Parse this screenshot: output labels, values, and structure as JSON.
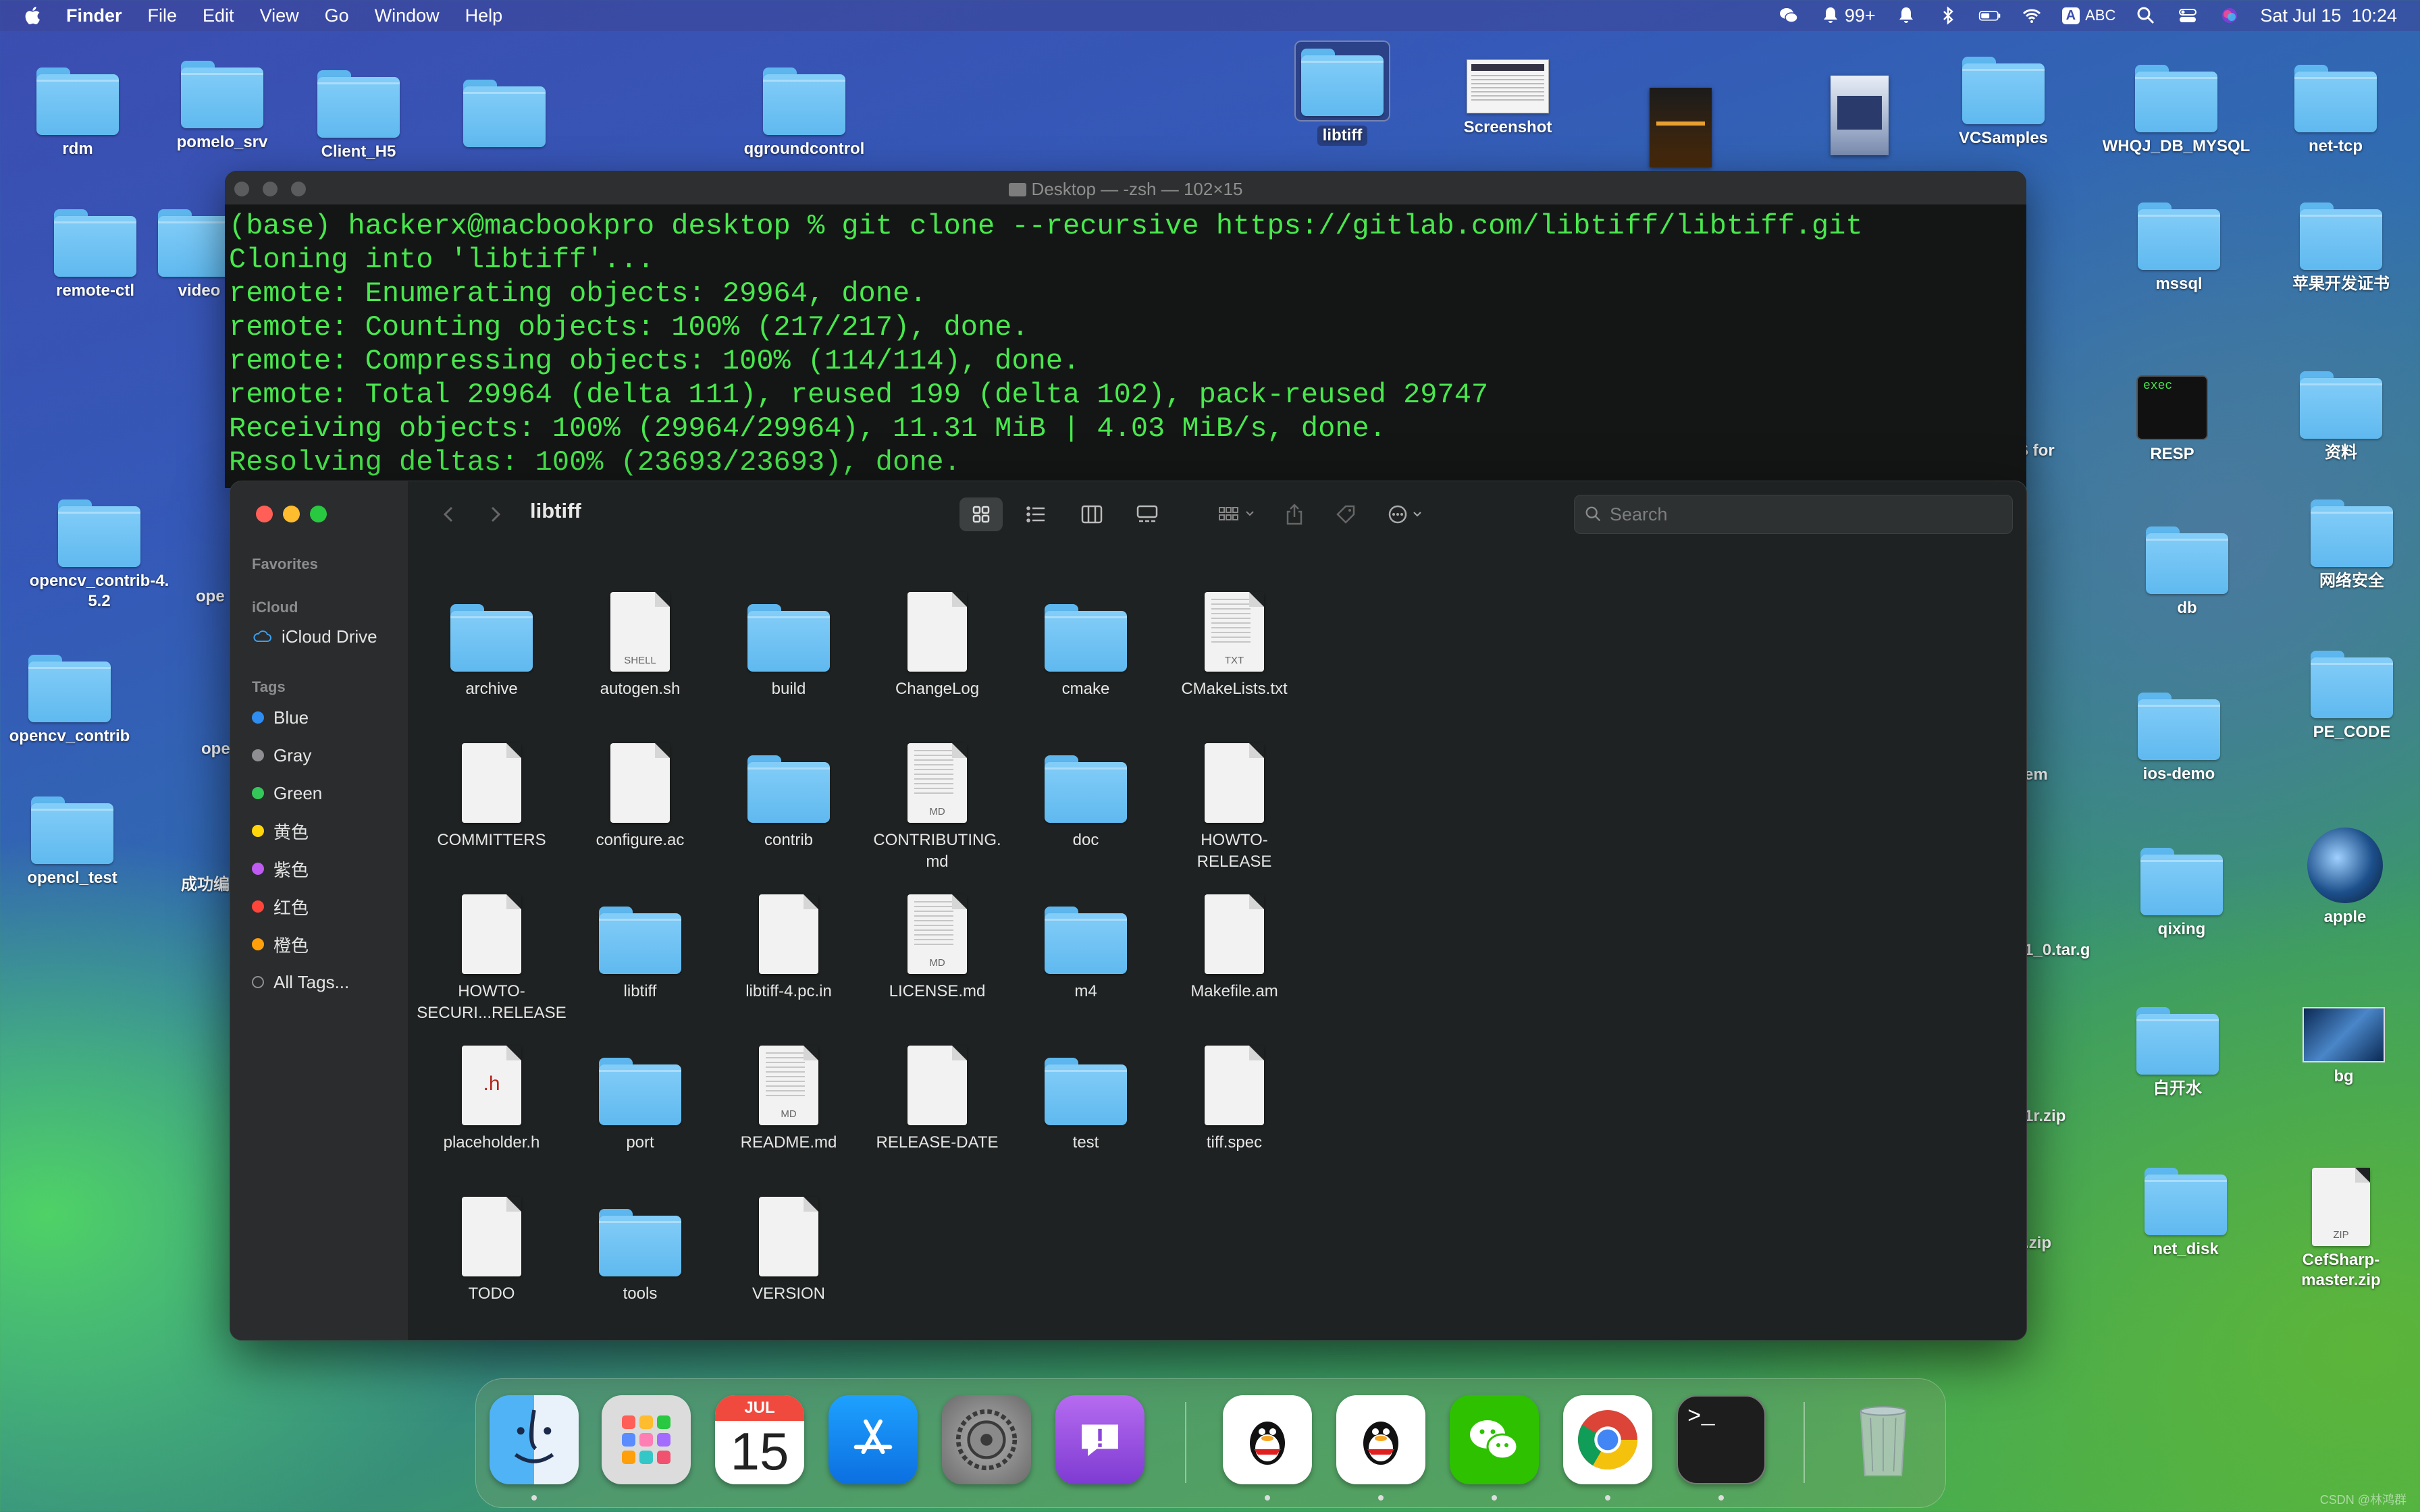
{
  "menubar": {
    "app": "Finder",
    "items": [
      "File",
      "Edit",
      "View",
      "Go",
      "Window",
      "Help"
    ],
    "notification_count": "99+",
    "input_mode_badge": "A",
    "input_mode_label": "ABC",
    "clock": "Sat Jul 15  10:24"
  },
  "desktop_icons": [
    {
      "label": "rdm",
      "type": "folder"
    },
    {
      "label": "pomelo_srv",
      "type": "folder"
    },
    {
      "label": "Client_H5",
      "type": "folder"
    },
    {
      "label": "",
      "type": "folder"
    },
    {
      "label": "qgroundcontrol",
      "type": "folder"
    },
    {
      "label": "libtiff",
      "type": "folder"
    },
    {
      "label": "Screenshot",
      "type": "image"
    },
    {
      "label": "",
      "type": "book"
    },
    {
      "label": "",
      "type": "book"
    },
    {
      "label": "VCSamples",
      "type": "folder"
    },
    {
      "label": "WHQJ_DB_MYSQL",
      "type": "folder"
    },
    {
      "label": "net-tcp",
      "type": "folder"
    },
    {
      "label": "remote-ctl",
      "type": "folder"
    },
    {
      "label": "video",
      "type": "folder"
    },
    {
      "label": "mssql",
      "type": "folder"
    },
    {
      "label": "苹果开发证书",
      "type": "folder"
    },
    {
      "label": "RESP",
      "type": "exec"
    },
    {
      "label": "资料",
      "type": "folder"
    },
    {
      "label": "ES for",
      "type": "text"
    },
    {
      "label": "opencv_contrib-4.\n5.2",
      "type": "folder"
    },
    {
      "label": "ope",
      "type": "folder"
    },
    {
      "label": "db",
      "type": "folder"
    },
    {
      "label": "网络安全",
      "type": "folder"
    },
    {
      "label": "opencv_contrib",
      "type": "folder"
    },
    {
      "label": "ope",
      "type": "folder"
    },
    {
      "label": "PE_CODE",
      "type": "folder"
    },
    {
      "label": "em",
      "type": "text"
    },
    {
      "label": "ios-demo",
      "type": "folder"
    },
    {
      "label": "opencl_test",
      "type": "folder"
    },
    {
      "label": "成功编",
      "type": "folder"
    },
    {
      "label": "1_0.tar.g",
      "type": "doc"
    },
    {
      "label": "qixing",
      "type": "folder"
    },
    {
      "label": "apple",
      "type": "image"
    },
    {
      "label": "1r.zip",
      "type": "doc"
    },
    {
      "label": "白开水",
      "type": "folder"
    },
    {
      "label": "bg",
      "type": "image"
    },
    {
      "label": ".zip",
      "type": "doc"
    },
    {
      "label": "net_disk",
      "type": "folder"
    },
    {
      "label": "CefSharp-\nmaster.zip",
      "type": "zip"
    }
  ],
  "terminal": {
    "title": "Desktop — -zsh — 102×15",
    "lines": [
      "(base) hackerx@macbookpro desktop % git clone --recursive https://gitlab.com/libtiff/libtiff.git",
      "Cloning into 'libtiff'...",
      "remote: Enumerating objects: 29964, done.",
      "remote: Counting objects: 100% (217/217), done.",
      "remote: Compressing objects: 100% (114/114), done.",
      "remote: Total 29964 (delta 111), reused 199 (delta 102), pack-reused 29747",
      "Receiving objects: 100% (29964/29964), 11.31 MiB | 4.03 MiB/s, done.",
      "Resolving deltas: 100% (23693/23693), done."
    ]
  },
  "finder": {
    "title": "libtiff",
    "search_placeholder": "Search",
    "sidebar": {
      "favorites_header": "Favorites",
      "icloud_header": "iCloud",
      "icloud_drive": "iCloud Drive",
      "tags_header": "Tags",
      "tags": [
        {
          "label": "Blue",
          "color": "#2f8cf0"
        },
        {
          "label": "Gray",
          "color": "#8e8e93"
        },
        {
          "label": "Green",
          "color": "#34c759"
        },
        {
          "label": "黄色",
          "color": "#ffd60a"
        },
        {
          "label": "紫色",
          "color": "#bf5af2"
        },
        {
          "label": "红色",
          "color": "#ff453a"
        },
        {
          "label": "橙色",
          "color": "#ff9f0a"
        }
      ],
      "all_tags": "All Tags..."
    },
    "files": [
      {
        "name": "archive",
        "kind": "folder",
        "tag": ""
      },
      {
        "name": "autogen.sh",
        "kind": "doc",
        "tag": "SHELL"
      },
      {
        "name": "build",
        "kind": "folder",
        "tag": ""
      },
      {
        "name": "ChangeLog",
        "kind": "doc",
        "tag": ""
      },
      {
        "name": "cmake",
        "kind": "folder",
        "tag": ""
      },
      {
        "name": "CMakeLists.txt",
        "kind": "doc",
        "tag": "TXT"
      },
      {
        "name": "COMMITTERS",
        "kind": "doc",
        "tag": ""
      },
      {
        "name": "configure.ac",
        "kind": "doc",
        "tag": ""
      },
      {
        "name": "contrib",
        "kind": "folder",
        "tag": ""
      },
      {
        "name": "CONTRIBUTING.\nmd",
        "kind": "doc",
        "tag": "MD"
      },
      {
        "name": "doc",
        "kind": "folder",
        "tag": ""
      },
      {
        "name": "HOWTO-\nRELEASE",
        "kind": "doc",
        "tag": ""
      },
      {
        "name": "HOWTO-\nSECURI...RELEASE",
        "kind": "doc",
        "tag": ""
      },
      {
        "name": "libtiff",
        "kind": "folder",
        "tag": ""
      },
      {
        "name": "libtiff-4.pc.in",
        "kind": "doc",
        "tag": ""
      },
      {
        "name": "LICENSE.md",
        "kind": "doc",
        "tag": "MD"
      },
      {
        "name": "m4",
        "kind": "folder",
        "tag": ""
      },
      {
        "name": "Makefile.am",
        "kind": "doc",
        "tag": ""
      },
      {
        "name": "placeholder.h",
        "kind": "doc",
        "tag": "h"
      },
      {
        "name": "port",
        "kind": "folder",
        "tag": ""
      },
      {
        "name": "README.md",
        "kind": "doc",
        "tag": "MD"
      },
      {
        "name": "RELEASE-DATE",
        "kind": "doc",
        "tag": ""
      },
      {
        "name": "test",
        "kind": "folder",
        "tag": ""
      },
      {
        "name": "tiff.spec",
        "kind": "doc",
        "tag": ""
      },
      {
        "name": "TODO",
        "kind": "doc",
        "tag": ""
      },
      {
        "name": "tools",
        "kind": "folder",
        "tag": ""
      },
      {
        "name": "VERSION",
        "kind": "doc",
        "tag": ""
      }
    ]
  },
  "dock": {
    "calendar_month": "JUL",
    "calendar_day": "15",
    "apps": [
      "finder-icon",
      "launchpad-icon",
      "calendar-icon",
      "app-store-icon",
      "system-settings-icon",
      "feedback-icon",
      "qq-icon",
      "qq-icon",
      "wechat-icon",
      "chrome-icon",
      "terminal-icon",
      "trash-icon"
    ]
  },
  "watermark": "CSDN @林鸿群"
}
